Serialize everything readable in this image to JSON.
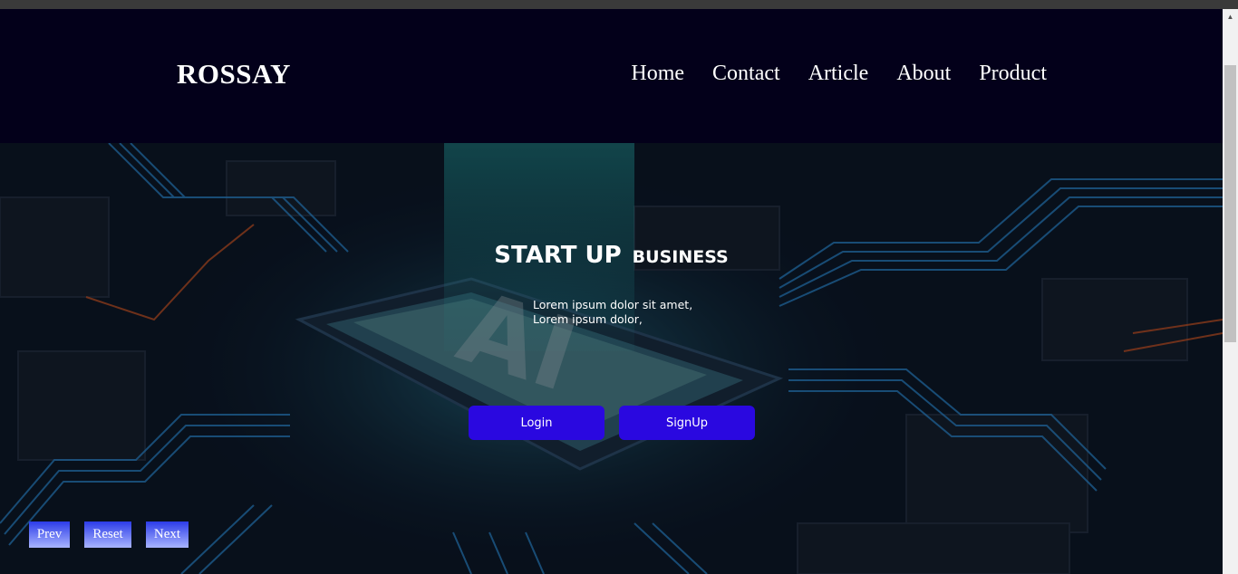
{
  "navbar": {
    "logo": "ROSSAY",
    "links": [
      {
        "label": "Home"
      },
      {
        "label": "Contact"
      },
      {
        "label": "Article"
      },
      {
        "label": "About"
      },
      {
        "label": "Product"
      }
    ]
  },
  "hero": {
    "title_main": "START UP",
    "title_sub": "BUSINESS",
    "text_line1": "Lorem ipsum dolor sit amet,",
    "text_line2": "Lorem ipsum dolor,",
    "image_text": "AI",
    "login_label": "Login",
    "signup_label": "SignUp"
  },
  "controls": {
    "prev_label": "Prev",
    "reset_label": "Reset",
    "next_label": "Next"
  },
  "colors": {
    "navbar_bg": "#03001a",
    "button_bg": "#2a08e0",
    "circuit_blue": "#2f8fd8"
  },
  "icons": {
    "scroll_up": "up-arrow-icon"
  }
}
